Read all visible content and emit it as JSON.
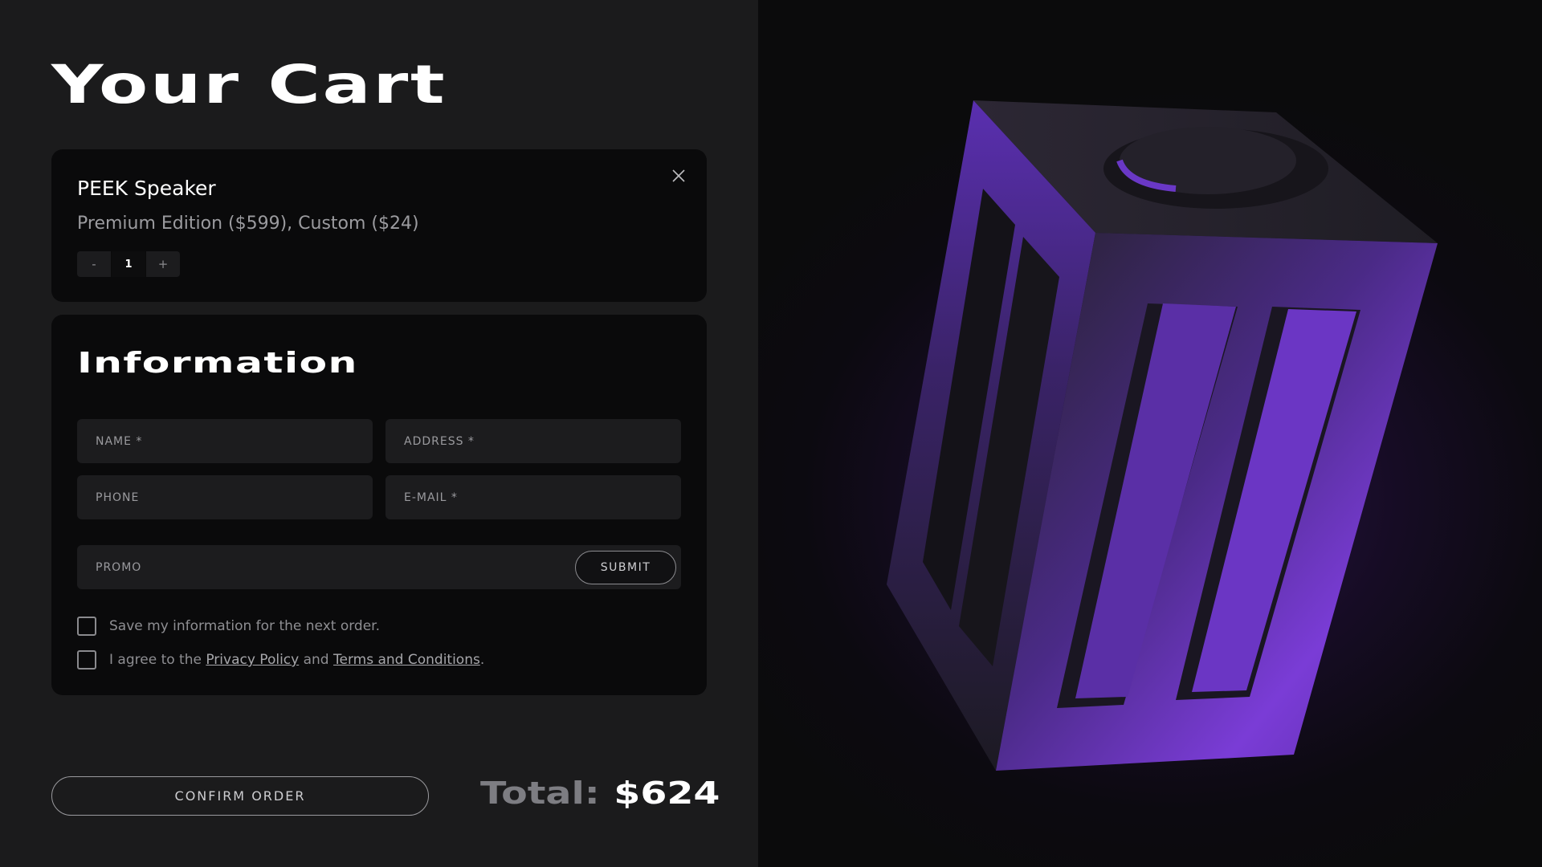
{
  "cart": {
    "title": "Your Cart",
    "item": {
      "name": "PEEK Speaker",
      "description": "Premium Edition ($599), Custom ($24)",
      "quantity": "1",
      "minus_label": "-",
      "plus_label": "+"
    }
  },
  "info": {
    "title": "Information",
    "name_placeholder": "NAME *",
    "address_placeholder": "ADDRESS *",
    "phone_placeholder": "PHONE",
    "email_placeholder": "E-MAIL *",
    "promo_placeholder": "PROMO",
    "submit_label": "SUBMIT",
    "save_info_label": "Save my information for the next order.",
    "agree_prefix": "I agree to the ",
    "privacy_link": "Privacy Policy",
    "agree_and": " and ",
    "terms_link": "Terms and Conditions",
    "agree_suffix": "."
  },
  "footer": {
    "confirm_label": "CONFIRM ORDER",
    "total_label": "Total:",
    "total_value": "$624"
  },
  "icons": {
    "close_main": "close-icon",
    "remove_item": "close-icon"
  },
  "colors": {
    "accent": "#7a3cd6",
    "panel_bg": "#1b1b1c",
    "card_bg": "#0a0a0b"
  }
}
